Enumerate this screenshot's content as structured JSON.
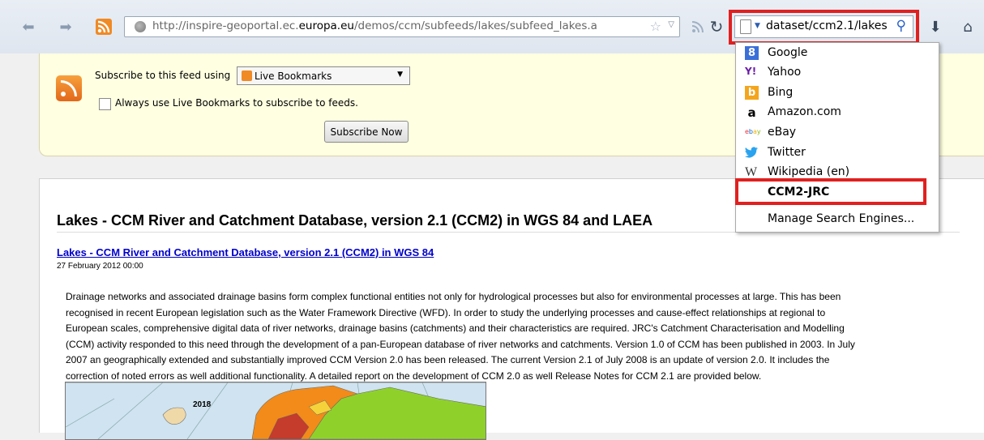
{
  "browser": {
    "url_prefix": "http://inspire-geoportal.ec.",
    "url_host": "europa.eu",
    "url_path": "/demos/ccm/subfeeds/lakes/subfeed_lakes.a",
    "search_text": "dataset/ccm2.1/lakes",
    "icons": [
      "back-icon",
      "forward-icon",
      "rss-icon",
      "globe-icon",
      "star-icon",
      "feed-icon",
      "reload-icon",
      "download-icon",
      "home-icon",
      "search-icon"
    ]
  },
  "feed": {
    "subscribe_label": "Subscribe to this feed using",
    "reader": "Live Bookmarks",
    "always_label": "Always use Live Bookmarks to subscribe to feeds.",
    "subscribe_button": "Subscribe Now"
  },
  "article": {
    "title": "Lakes - CCM River and Catchment Database, version 2.1 (CCM2) in WGS 84 and LAEA",
    "link": "Lakes - CCM River and Catchment Database, version 2.1 (CCM2) in WGS 84",
    "date": "27 February 2012 00:00",
    "body_lines": [
      "Drainage networks and associated drainage basins form complex functional entities not only for hydrological processes but also for environmental processes at large. This has been",
      "recognised in recent European legislation such as the Water Framework Directive (WFD). In order to study the underlying processes and cause-effect relationships at regional to",
      "European scales, comprehensive digital data of river networks, drainage basins (catchments) and their characteristics are required. JRC's Catchment Characterisation and Modelling",
      "(CCM) activity responded to this need through the development of a pan-European database of river networks and catchments. Version 1.0 of CCM has been published in 2003. In July",
      "2007 an geographically extended and substantially improved CCM Version 2.0 has been released. The current Version 2.1 of July 2008 is an update of version 2.0. It includes the",
      "correction of noted errors as well additional functionality. A detailed report on the development of CCM 2.0 as well Release Notes for CCM 2.1 are provided below."
    ],
    "map_label": "2018"
  },
  "search_engines": {
    "items": [
      {
        "label": "Google",
        "icon": "google-icon",
        "color": "#3b6fd8"
      },
      {
        "label": "Yahoo",
        "icon": "yahoo-icon",
        "color": "#6b1ea8"
      },
      {
        "label": "Bing",
        "icon": "bing-icon",
        "color": "#f4a51c"
      },
      {
        "label": "Amazon.com",
        "icon": "amazon-icon",
        "color": "#000000"
      },
      {
        "label": "eBay",
        "icon": "ebay-icon",
        "color": "#e53238"
      },
      {
        "label": "Twitter",
        "icon": "twitter-icon",
        "color": "#2aa3ef"
      },
      {
        "label": "Wikipedia (en)",
        "icon": "wikipedia-icon",
        "color": "#333333"
      }
    ],
    "highlighted": "CCM2-JRC",
    "manage": "Manage Search Engines..."
  },
  "colors": {
    "highlight_border": "#e02020",
    "feed_background": "#ffffe1",
    "link": "#0000cc"
  }
}
